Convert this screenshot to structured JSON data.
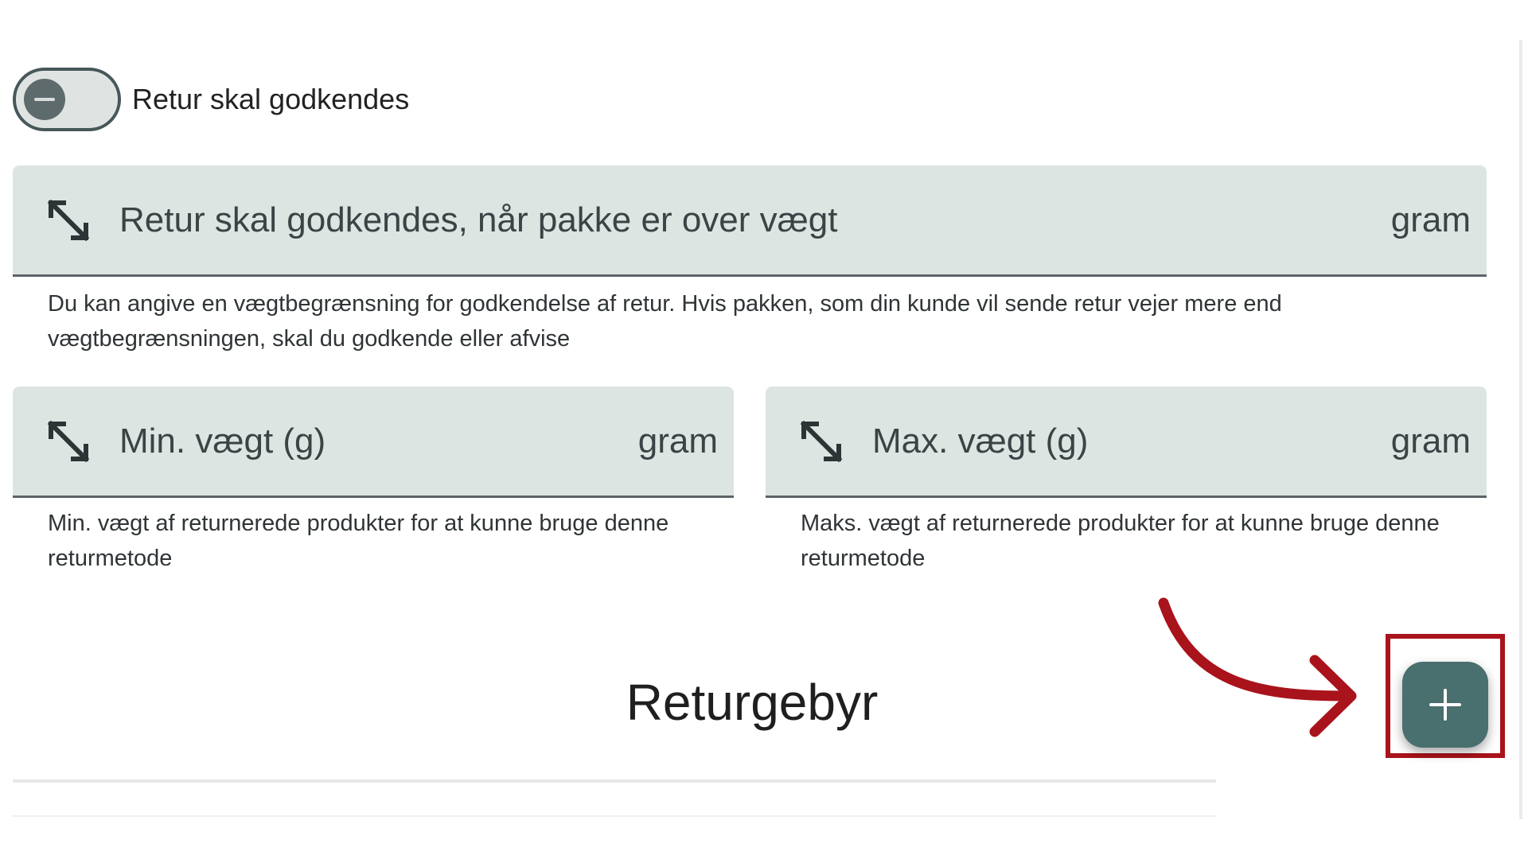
{
  "approval_toggle": {
    "label": "Retur skal godkendes",
    "state": "off"
  },
  "weight_threshold_field": {
    "label": "Retur skal godkendes, når pakke er over vægt",
    "unit": "gram",
    "helper": "Du kan angive en vægtbegrænsning for godkendelse af retur. Hvis pakken, som din kunde vil sende retur vejer mere end vægtbegrænsningen, skal du godkende eller afvise"
  },
  "min_weight_field": {
    "label": "Min. vægt (g)",
    "unit": "gram",
    "helper": "Min. vægt af returnerede produkter for at kunne bruge denne returmetode"
  },
  "max_weight_field": {
    "label": "Max. vægt (g)",
    "unit": "gram",
    "helper": "Maks. vægt af returnerede produkter for at kunne bruge denne returmetode"
  },
  "return_fee": {
    "title": "Returgebyr",
    "add_button_icon": "plus-icon"
  },
  "icons": {
    "field_icon": "resize-diagonal-icon",
    "annotation_arrow": "curved-arrow-icon"
  },
  "colors": {
    "fab": "#496f6e",
    "field_background": "#dde5e3",
    "highlight": "#a9131b"
  }
}
